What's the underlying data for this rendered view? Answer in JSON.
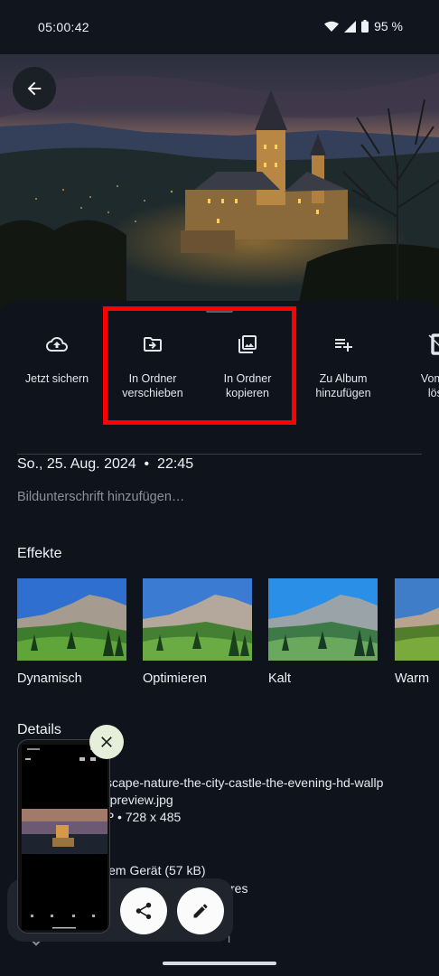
{
  "status_bar": {
    "time": "05:00:42",
    "battery": "95 %"
  },
  "actions": [
    {
      "label": "Jetzt sichern",
      "icon": "cloud-upload-icon"
    },
    {
      "label": "In Ordner\nverschieben",
      "icon": "folder-move-icon"
    },
    {
      "label": "In Ordner\nkopieren",
      "icon": "copy-to-folder-icon"
    },
    {
      "label": "Zu Album\nhinzufügen",
      "icon": "playlist-add-icon"
    },
    {
      "label": "Vom G\nlösc",
      "icon": "device-delete-icon"
    }
  ],
  "info": {
    "date": "So., 25. Aug. 2024  •  22:45",
    "caption_placeholder": "Bildunterschrift hinzufügen…"
  },
  "effects": {
    "title": "Effekte",
    "items": [
      {
        "label": "Dynamisch"
      },
      {
        "label": "Optimieren"
      },
      {
        "label": "Kalt"
      },
      {
        "label": "Warm"
      }
    ]
  },
  "details": {
    "title": "Details",
    "filename_line1": "scape-nature-the-city-castle-the-evening-hd-wallp",
    "filename_line2": "-preview.jpg",
    "meta": "P  •  728 x 485",
    "storage": "lem Gerät (57 kB)",
    "path": "res",
    "partial_line": "l"
  },
  "colors": {
    "background": "#0f141c",
    "highlight": "#ff0000",
    "float_button": "#fbfbfb",
    "pip_close": "#e6efd9"
  }
}
